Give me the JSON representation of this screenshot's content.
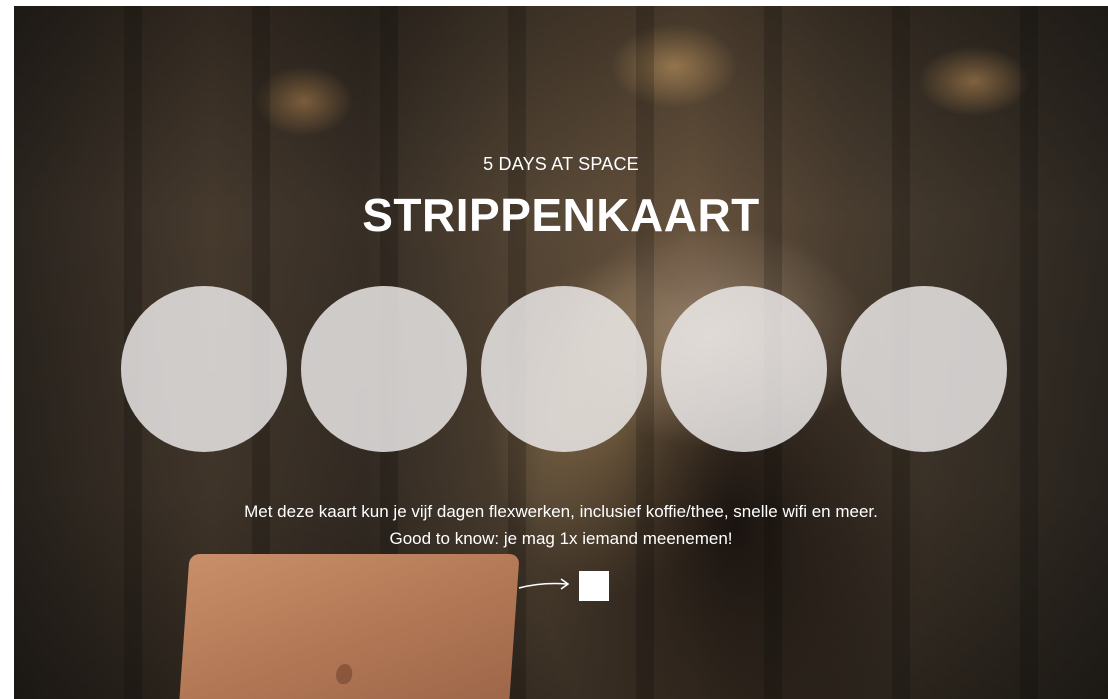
{
  "card": {
    "subtitle": "5 DAYS AT SPACE",
    "title": "STRIPPENKAART",
    "description_line1": "Met deze kaart kun je vijf dagen flexwerken, inclusief koffie/thee, snelle wifi en meer.",
    "description_line2": "Good to know: je mag 1x iemand meenemen!"
  },
  "strips": {
    "total": 5,
    "used": 0
  },
  "icons": {
    "arrow": "arrow-right-icon",
    "checkbox": "checkbox-square"
  },
  "colors": {
    "text": "#ffffff",
    "circle_fill": "#f0eeee",
    "checkbox": "#ffffff"
  }
}
